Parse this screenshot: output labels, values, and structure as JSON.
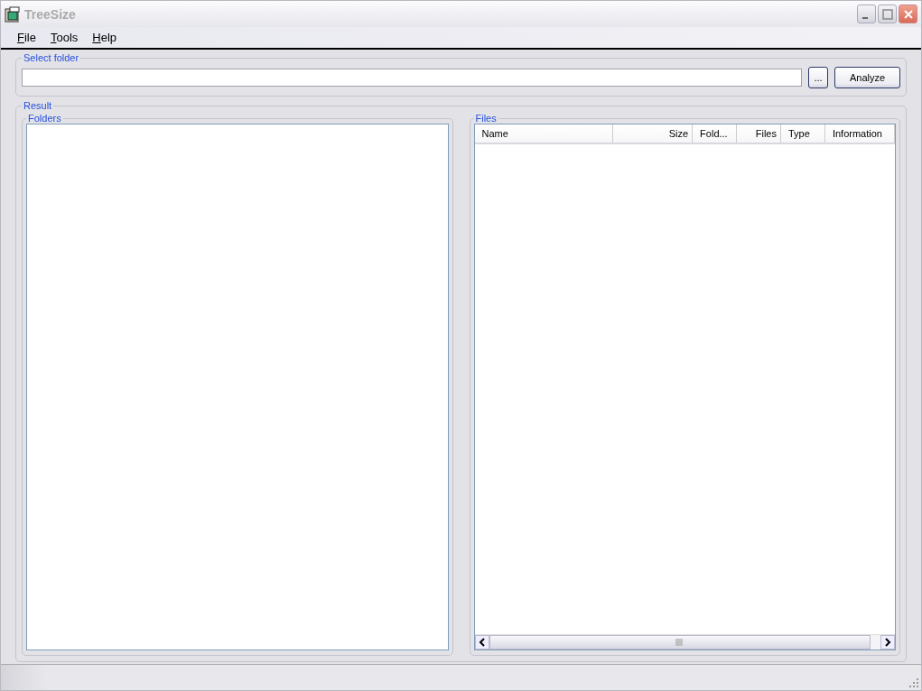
{
  "window": {
    "title": "TreeSize"
  },
  "menu": [
    "File",
    "Tools",
    "Help"
  ],
  "select_folder": {
    "legend": "Select folder",
    "browse_button": "...",
    "analyze_button": "Analyze"
  },
  "result": {
    "legend": "Result",
    "folders": {
      "legend": "Folders"
    },
    "files": {
      "legend": "Files",
      "columns": [
        {
          "label": "Name",
          "kind": "text"
        },
        {
          "label": "Size",
          "kind": "numeric"
        },
        {
          "label": "Fold...",
          "kind": "text"
        },
        {
          "label": "Files",
          "kind": "numeric"
        },
        {
          "label": "Type",
          "kind": "text"
        },
        {
          "label": "Information",
          "kind": "text"
        }
      ]
    }
  }
}
